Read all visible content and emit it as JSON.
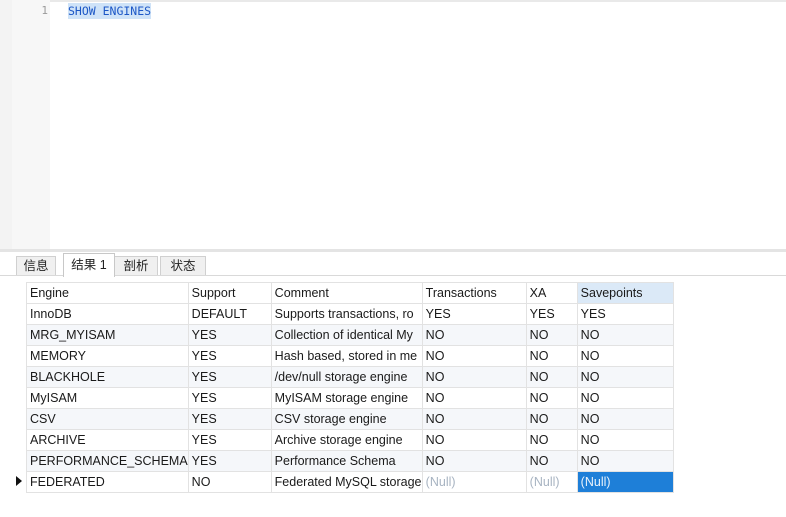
{
  "editor": {
    "line_number": "1",
    "code": "SHOW ENGINES"
  },
  "tabs": [
    {
      "label": "信息",
      "active": false
    },
    {
      "label": "结果 1",
      "active": true
    },
    {
      "label": "剖析",
      "active": false
    },
    {
      "label": "状态",
      "active": false
    }
  ],
  "grid": {
    "columns": [
      "Engine",
      "Support",
      "Comment",
      "Transactions",
      "XA",
      "Savepoints"
    ],
    "selected_column": "Savepoints",
    "current_row": 8,
    "rows": [
      [
        "InnoDB",
        "DEFAULT",
        "Supports transactions, ro",
        "YES",
        "YES",
        "YES"
      ],
      [
        "MRG_MYISAM",
        "YES",
        "Collection of identical My",
        "NO",
        "NO",
        "NO"
      ],
      [
        "MEMORY",
        "YES",
        "Hash based, stored in me",
        "NO",
        "NO",
        "NO"
      ],
      [
        "BLACKHOLE",
        "YES",
        "/dev/null storage engine",
        "NO",
        "NO",
        "NO"
      ],
      [
        "MyISAM",
        "YES",
        "MyISAM storage engine",
        "NO",
        "NO",
        "NO"
      ],
      [
        "CSV",
        "YES",
        "CSV storage engine",
        "NO",
        "NO",
        "NO"
      ],
      [
        "ARCHIVE",
        "YES",
        "Archive storage engine",
        "NO",
        "NO",
        "NO"
      ],
      [
        "PERFORMANCE_SCHEMA",
        "YES",
        "Performance Schema",
        "NO",
        "NO",
        "NO"
      ],
      [
        "FEDERATED",
        "NO",
        "Federated MySQL storage",
        "(Null)",
        "(Null)",
        "(Null)"
      ]
    ]
  }
}
